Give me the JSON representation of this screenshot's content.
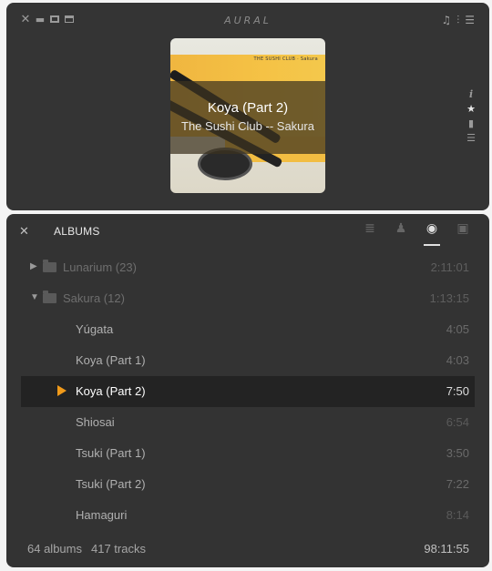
{
  "player": {
    "logo": "AURAL",
    "now_playing": {
      "title": "Koya (Part 2)",
      "subtitle": "The Sushi Club -- Sakura",
      "cover_text": "THE SUSHI CLUB · Sakura"
    }
  },
  "library": {
    "title": "ALBUMS",
    "active_view": "albums",
    "rows": [
      {
        "kind": "album",
        "label": "Lunarium (23)",
        "duration": "2:11:01",
        "expanded": false
      },
      {
        "kind": "album",
        "label": "Sakura (12)",
        "duration": "1:13:15",
        "expanded": true
      },
      {
        "kind": "track",
        "label": "Yúgata",
        "duration": "4:05"
      },
      {
        "kind": "track",
        "label": "Koya (Part 1)",
        "duration": "4:03"
      },
      {
        "kind": "track",
        "label": "Koya (Part 2)",
        "duration": "7:50",
        "playing": true
      },
      {
        "kind": "track",
        "label": "Shiosai",
        "duration": "6:54"
      },
      {
        "kind": "track",
        "label": "Tsuki (Part 1)",
        "duration": "3:50"
      },
      {
        "kind": "track",
        "label": "Tsuki (Part 2)",
        "duration": "7:22"
      },
      {
        "kind": "track",
        "label": "Hamaguri",
        "duration": "8:14"
      }
    ],
    "footer": {
      "albums": "64 albums",
      "tracks": "417 tracks",
      "total": "98:11:55"
    }
  },
  "colors": {
    "accent_play": "#f09a1a",
    "panel_bg": "#333333",
    "playing_row_bg": "#232323"
  }
}
